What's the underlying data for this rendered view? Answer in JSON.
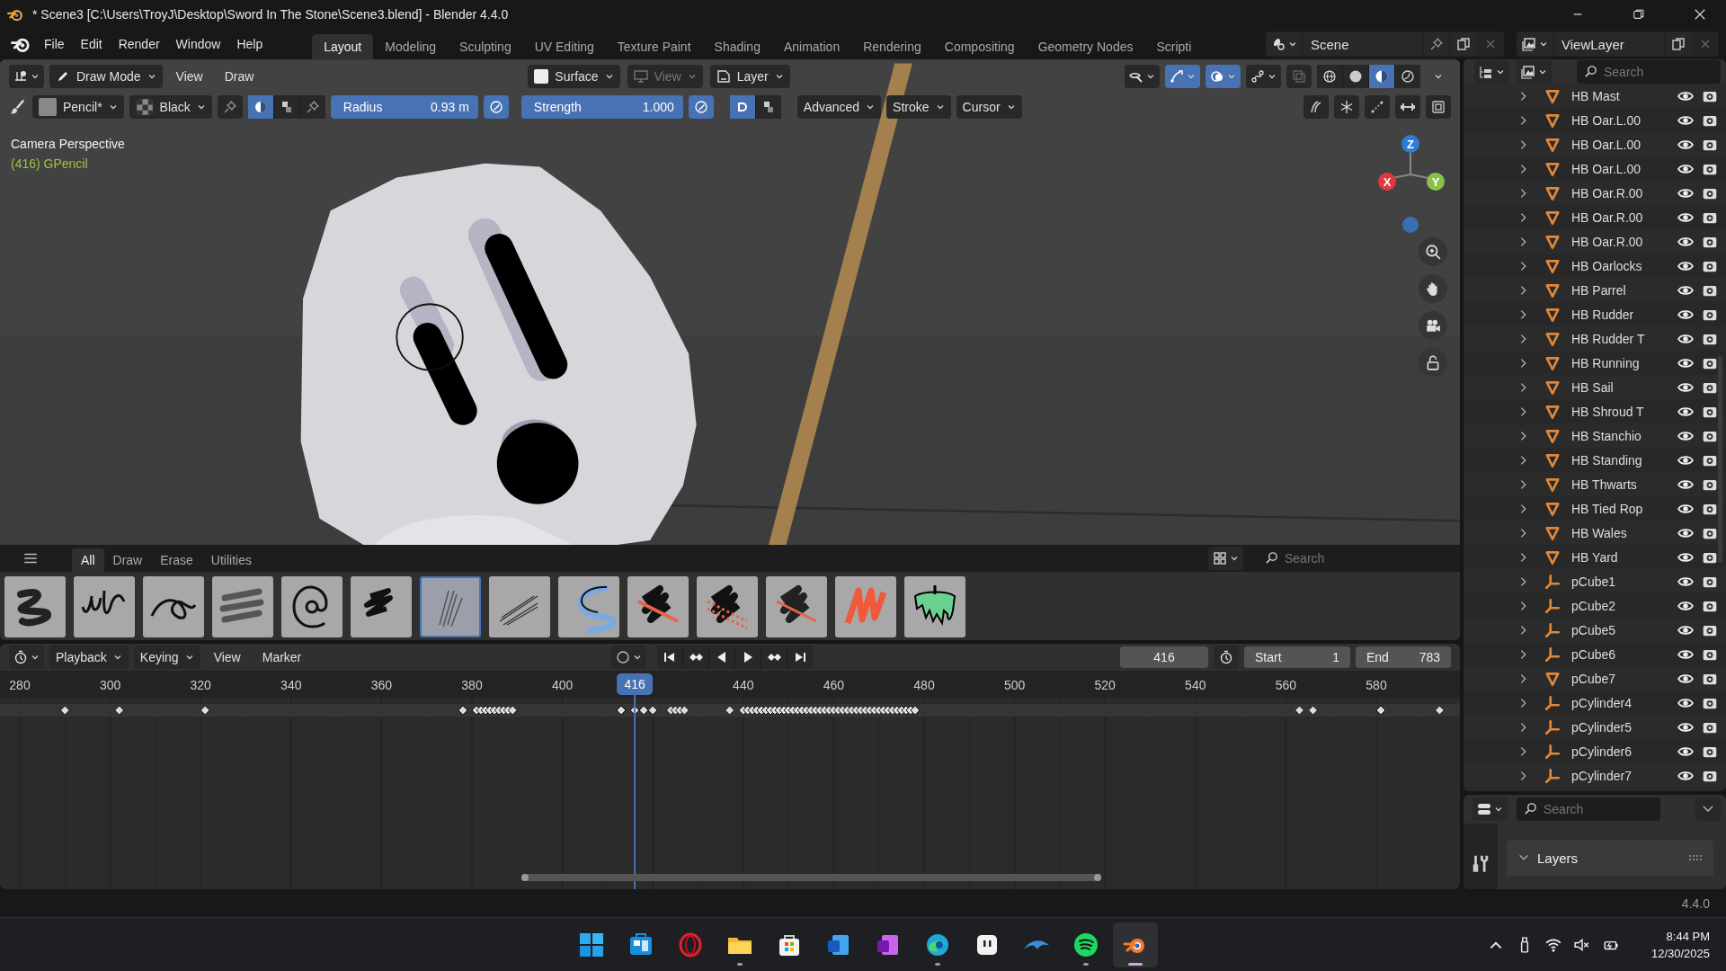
{
  "window": {
    "title": "* Scene3 [C:\\Users\\TroyJ\\Desktop\\Sword In The Stone\\Scene3.blend] - Blender 4.4.0"
  },
  "menu": [
    "File",
    "Edit",
    "Render",
    "Window",
    "Help"
  ],
  "workspaces": [
    {
      "label": "Layout",
      "selected": true
    },
    {
      "label": "Modeling",
      "selected": false
    },
    {
      "label": "Sculpting",
      "selected": false
    },
    {
      "label": "UV Editing",
      "selected": false
    },
    {
      "label": "Texture Paint",
      "selected": false
    },
    {
      "label": "Shading",
      "selected": false
    },
    {
      "label": "Animation",
      "selected": false
    },
    {
      "label": "Rendering",
      "selected": false
    },
    {
      "label": "Compositing",
      "selected": false
    },
    {
      "label": "Geometry Nodes",
      "selected": false
    },
    {
      "label": "Scripti",
      "selected": false
    }
  ],
  "scene": "Scene",
  "view_layer": "ViewLayer",
  "viewport": {
    "header": {
      "mode": "Draw Mode",
      "menus": [
        "View",
        "Draw"
      ],
      "placement": "Surface",
      "view": {
        "label": "View",
        "disabled": true
      },
      "layer": "Layer"
    },
    "shading": [
      {
        "selected": false
      },
      {
        "selected": false
      },
      {
        "selected": true
      },
      {
        "selected": false
      }
    ],
    "tool_settings": {
      "brush": "Pencil*",
      "material": "Black",
      "radius": {
        "label": "Radius",
        "value": "0.93 m"
      },
      "strength": {
        "label": "Strength",
        "value": "1.000"
      },
      "menus": [
        "Advanced",
        "Stroke",
        "Cursor"
      ]
    },
    "overlay_title": "Camera Perspective",
    "object_info": "(416) GPencil",
    "gizmo_axes": [
      {
        "label": "Z",
        "color": "#2f7bd6"
      },
      {
        "label": "X",
        "color": "#e0383e"
      },
      {
        "label": "Y",
        "color": "#8bc34a"
      }
    ],
    "asset_shelf": {
      "tabs": [
        {
          "label": "All",
          "selected": true
        },
        {
          "label": "Draw",
          "selected": false
        },
        {
          "label": "Erase",
          "selected": false
        },
        {
          "label": "Utilities",
          "selected": false
        }
      ],
      "search": {
        "placeholder": "Search"
      },
      "brushes": [
        {
          "selected": false
        },
        {
          "selected": false
        },
        {
          "selected": false
        },
        {
          "selected": false
        },
        {
          "selected": false
        },
        {
          "selected": false
        },
        {
          "selected": true
        },
        {
          "selected": false
        },
        {
          "selected": false
        },
        {
          "selected": false
        },
        {
          "selected": false
        },
        {
          "selected": false
        },
        {
          "selected": false
        },
        {
          "selected": false
        }
      ]
    }
  },
  "timeline": {
    "menus": [
      "Playback",
      "Keying",
      "View",
      "Marker"
    ],
    "current_frame": "416",
    "start": {
      "label": "Start",
      "value": "1"
    },
    "end": {
      "label": "End",
      "value": "783"
    },
    "ruler": [
      "280",
      "300",
      "320",
      "340",
      "360",
      "380",
      "400",
      "440",
      "460",
      "480",
      "500",
      "520",
      "540",
      "560",
      "580"
    ],
    "playhead": "416"
  },
  "outliner": {
    "search": {
      "placeholder": "Search"
    },
    "items": [
      {
        "name": "HB Mast",
        "kind": "mesh"
      },
      {
        "name": "HB Oar.L.00",
        "kind": "mesh"
      },
      {
        "name": "HB Oar.L.00",
        "kind": "mesh"
      },
      {
        "name": "HB Oar.L.00",
        "kind": "mesh"
      },
      {
        "name": "HB Oar.R.00",
        "kind": "mesh"
      },
      {
        "name": "HB Oar.R.00",
        "kind": "mesh"
      },
      {
        "name": "HB Oar.R.00",
        "kind": "mesh"
      },
      {
        "name": "HB Oarlocks",
        "kind": "mesh"
      },
      {
        "name": "HB Parrel",
        "kind": "mesh"
      },
      {
        "name": "HB Rudder",
        "kind": "mesh"
      },
      {
        "name": "HB Rudder T",
        "kind": "mesh"
      },
      {
        "name": "HB Running",
        "kind": "mesh"
      },
      {
        "name": "HB Sail",
        "kind": "mesh"
      },
      {
        "name": "HB Shroud T",
        "kind": "mesh"
      },
      {
        "name": "HB Stanchio",
        "kind": "mesh"
      },
      {
        "name": "HB Standing",
        "kind": "mesh"
      },
      {
        "name": "HB Thwarts",
        "kind": "mesh"
      },
      {
        "name": "HB Tied Rop",
        "kind": "mesh"
      },
      {
        "name": "HB Wales",
        "kind": "mesh"
      },
      {
        "name": "HB Yard",
        "kind": "mesh"
      },
      {
        "name": "pCube1",
        "kind": "empty"
      },
      {
        "name": "pCube2",
        "kind": "empty"
      },
      {
        "name": "pCube5",
        "kind": "empty"
      },
      {
        "name": "pCube6",
        "kind": "empty"
      },
      {
        "name": "pCube7",
        "kind": "mesh"
      },
      {
        "name": "pCylinder4",
        "kind": "empty"
      },
      {
        "name": "pCylinder5",
        "kind": "empty"
      },
      {
        "name": "pCylinder6",
        "kind": "empty"
      },
      {
        "name": "pCylinder7",
        "kind": "empty"
      }
    ]
  },
  "properties": {
    "search": {
      "placeholder": "Search"
    },
    "panel": {
      "title": "Layers",
      "expanded": true
    }
  },
  "status_bar": {
    "version": "4.4.0"
  },
  "taskbar": {
    "apps": [
      {
        "kind": "tiles",
        "running": false,
        "selected": false
      },
      {
        "kind": "board",
        "running": false,
        "selected": false
      },
      {
        "kind": "ring",
        "running": false,
        "selected": false
      },
      {
        "kind": "folder",
        "running": true,
        "selected": false
      },
      {
        "kind": "bag",
        "running": false,
        "selected": false
      },
      {
        "kind": "doc",
        "running": false,
        "selected": false
      },
      {
        "kind": "notebook",
        "running": false,
        "selected": false
      },
      {
        "kind": "swirl",
        "running": true,
        "selected": false
      },
      {
        "kind": "face",
        "running": false,
        "selected": false
      },
      {
        "kind": "dolphin",
        "running": false,
        "selected": false
      },
      {
        "kind": "waves",
        "running": true,
        "selected": false
      },
      {
        "kind": "orbit",
        "running": true,
        "selected": true
      }
    ],
    "time": "8:44 PM",
    "date": "12/30/2025"
  }
}
